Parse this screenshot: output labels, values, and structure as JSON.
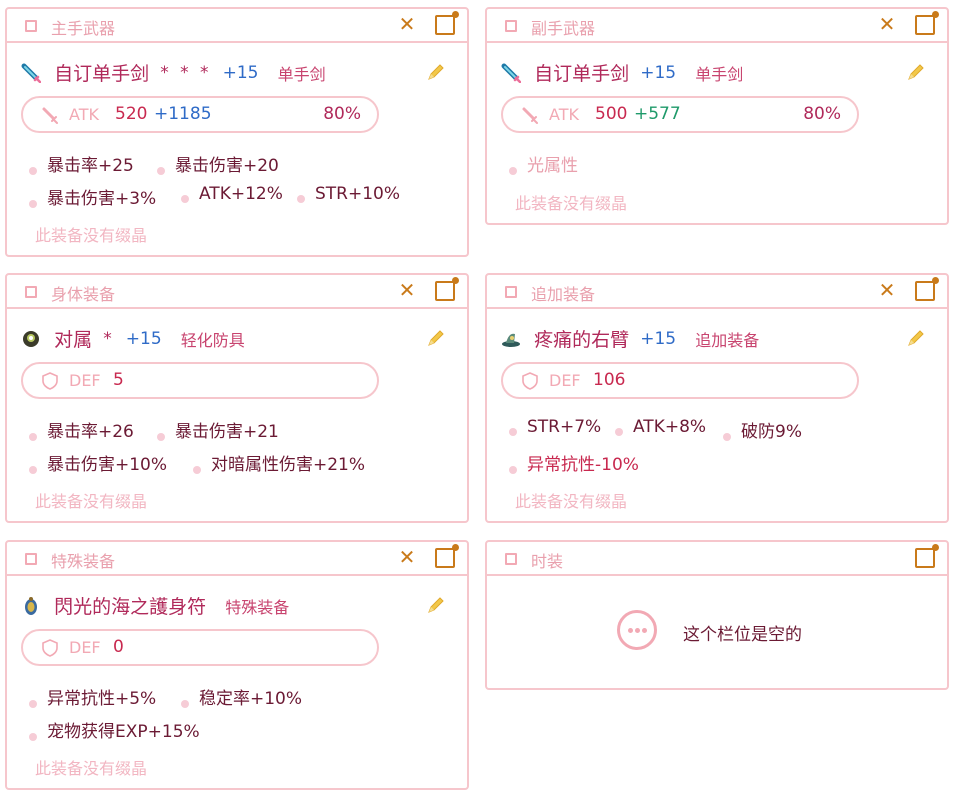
{
  "colors": {
    "border": "#f6c6cc",
    "accent": "#c97a1a",
    "name": "#b0295a",
    "refine": "#2f6bc7",
    "bonus_blue": "#2f6bc7",
    "bonus_green": "#1f9a6a"
  },
  "slots": {
    "main": {
      "title": "主手武器",
      "close": "✕",
      "name": "自订单手剑",
      "stars": "* * *",
      "refine": "+15",
      "type": "单手剑",
      "stat_label": "ATK",
      "stat_value": "520",
      "stat_bonus": "+1185",
      "stat_pct": "80%",
      "attrs": [
        "暴击率+25",
        "暴击伤害+20",
        "暴击伤害+3%",
        "ATK+12%",
        "STR+10%"
      ],
      "note": "此装备没有缀晶"
    },
    "sub": {
      "title": "副手武器",
      "close": "✕",
      "name": "自订单手剑",
      "refine": "+15",
      "type": "单手剑",
      "stat_label": "ATK",
      "stat_value": "500",
      "stat_bonus": "+577",
      "stat_pct": "80%",
      "attrs": [
        "光属性"
      ],
      "note": "此装备没有缀晶"
    },
    "body": {
      "title": "身体装备",
      "close": "✕",
      "name": "对属",
      "stars": "*",
      "refine": "+15",
      "type": "轻化防具",
      "stat_label": "DEF",
      "stat_value": "5",
      "attrs": [
        "暴击率+26",
        "暴击伤害+21",
        "暴击伤害+10%",
        "对暗属性伤害+21%"
      ],
      "note": "此装备没有缀晶"
    },
    "additional": {
      "title": "追加装备",
      "close": "✕",
      "name": "疼痛的右臂",
      "refine": "+15",
      "type": "追加装备",
      "stat_label": "DEF",
      "stat_value": "106",
      "attrs": [
        "STR+7%",
        "ATK+8%",
        "破防9%",
        "异常抗性-10%"
      ],
      "note": "此装备没有缀晶"
    },
    "special": {
      "title": "特殊装备",
      "close": "✕",
      "name": "閃光的海之護身符",
      "type": "特殊装备",
      "stat_label": "DEF",
      "stat_value": "0",
      "attrs": [
        "异常抗性+5%",
        "稳定率+10%",
        "宠物获得EXP+15%"
      ],
      "note": "此装备没有缀晶"
    },
    "avatar": {
      "title": "时装",
      "empty_text": "这个栏位是空的"
    }
  }
}
